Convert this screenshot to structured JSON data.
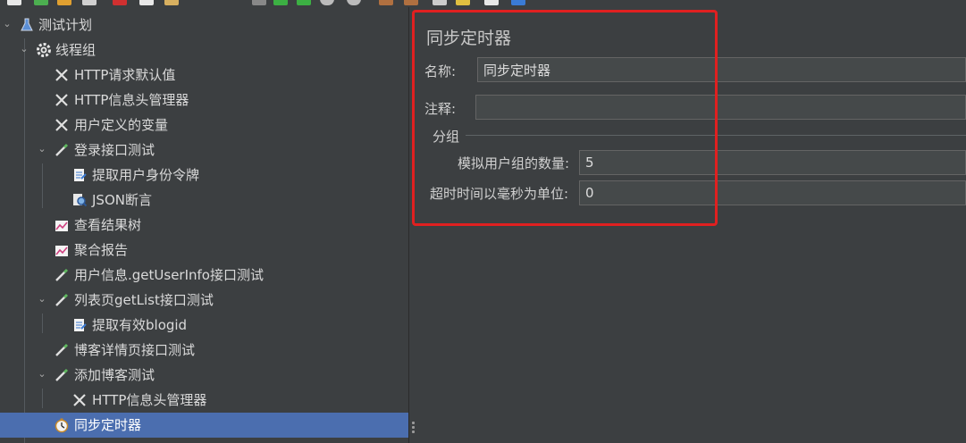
{
  "tree": {
    "items": [
      {
        "label": "测试计划",
        "icon": "flask-icon"
      },
      {
        "label": "线程组",
        "icon": "gear-icon"
      },
      {
        "label": "HTTP请求默认值",
        "icon": "wrench-icon"
      },
      {
        "label": "HTTP信息头管理器",
        "icon": "wrench-icon"
      },
      {
        "label": "用户定义的变量",
        "icon": "wrench-icon"
      },
      {
        "label": "登录接口测试",
        "icon": "pipette-icon"
      },
      {
        "label": "提取用户身份令牌",
        "icon": "extractor-icon"
      },
      {
        "label": "JSON断言",
        "icon": "magnifier-icon"
      },
      {
        "label": "查看结果树",
        "icon": "graph-icon"
      },
      {
        "label": "聚合报告",
        "icon": "graph-icon"
      },
      {
        "label": "用户信息.getUserInfo接口测试",
        "icon": "pipette-icon"
      },
      {
        "label": "列表页getList接口测试",
        "icon": "pipette-icon"
      },
      {
        "label": "提取有效blogid",
        "icon": "extractor-icon"
      },
      {
        "label": "博客详情页接口测试",
        "icon": "pipette-icon"
      },
      {
        "label": "添加博客测试",
        "icon": "pipette-icon"
      },
      {
        "label": "HTTP信息头管理器",
        "icon": "wrench-icon"
      },
      {
        "label": "同步定时器",
        "icon": "stopwatch-icon"
      }
    ]
  },
  "editor": {
    "title": "同步定时器",
    "name_label": "名称:",
    "name_value": "同步定时器",
    "comment_label": "注释:",
    "comment_value": "",
    "group_title": "分组",
    "users_label": "模拟用户组的数量:",
    "users_value": "5",
    "timeout_label": "超时时间以毫秒为单位:",
    "timeout_value": "0"
  },
  "colors": {
    "background": "#3c3f41",
    "selection": "#4b6eaf",
    "highlight_box": "#e02020"
  }
}
